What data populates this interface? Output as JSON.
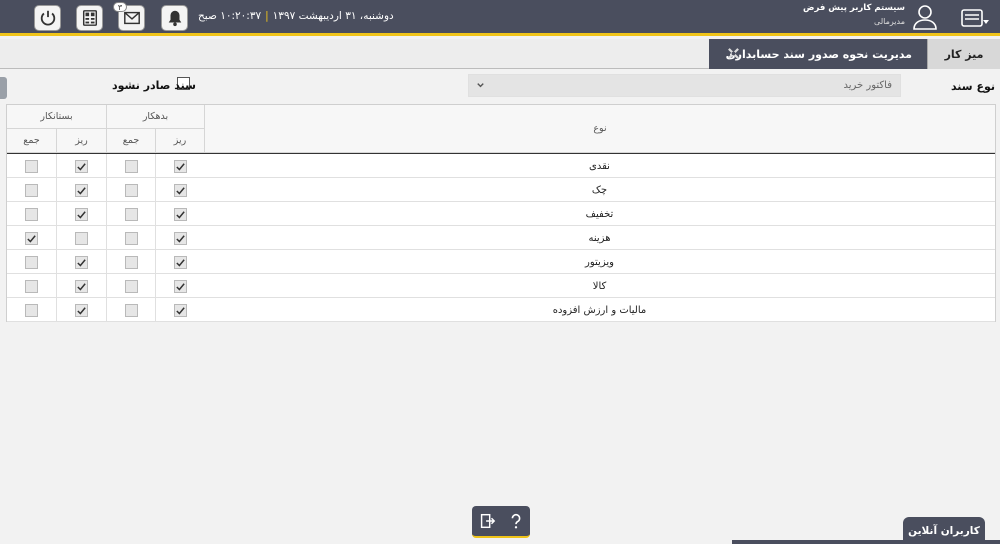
{
  "topbar": {
    "date": "دوشنبه، ۳۱ اردیبهشت ۱۳۹۷",
    "time": "۱۰:۲۰:۳۷ صبح",
    "mail_badge": "۳",
    "user_name": "سیستم کاربر پیش فرض",
    "user_role": "مدیرمالی"
  },
  "tabs": {
    "home_label": "میز کار",
    "active_label": "مدیریت نحوه صدور سند حسابداری"
  },
  "filter": {
    "doc_type_label": "نوع سند",
    "doc_type_value": "فاکتور خرید",
    "no_issue_label": "سند صادر نشود"
  },
  "table": {
    "col_type": "نوع",
    "group_debit": "بدهکار",
    "group_credit": "بستانکار",
    "sub_detail": "ریز",
    "sub_total": "جمع",
    "rows": [
      {
        "name": "نقدی",
        "debit_detail": true,
        "debit_total": false,
        "credit_detail": true,
        "credit_total": false
      },
      {
        "name": "چک",
        "debit_detail": true,
        "debit_total": false,
        "credit_detail": true,
        "credit_total": false
      },
      {
        "name": "تخفیف",
        "debit_detail": true,
        "debit_total": false,
        "credit_detail": true,
        "credit_total": false
      },
      {
        "name": "هزینه",
        "debit_detail": true,
        "debit_total": false,
        "credit_detail": false,
        "credit_total": true
      },
      {
        "name": "ویزیتور",
        "debit_detail": true,
        "debit_total": false,
        "credit_detail": true,
        "credit_total": false
      },
      {
        "name": "کالا",
        "debit_detail": true,
        "debit_total": false,
        "credit_detail": true,
        "credit_total": false
      },
      {
        "name": "مالیات و ارزش افزوده",
        "debit_detail": true,
        "debit_total": false,
        "credit_detail": true,
        "credit_total": false
      }
    ]
  },
  "footer": {
    "online_users_label": "کاربران آنلاین"
  },
  "icons": {
    "power": "power-icon",
    "calculator": "calculator-icon",
    "mail": "mail-icon",
    "bell": "bell-icon",
    "user": "user-icon",
    "menu": "menu-icon",
    "close": "close-icon",
    "chevron": "chevron-down-icon",
    "check": "check-icon",
    "exit": "exit-icon",
    "help": "help-icon"
  },
  "colors": {
    "topbar_bg": "#4a4e5e",
    "accent": "#f0c419"
  }
}
